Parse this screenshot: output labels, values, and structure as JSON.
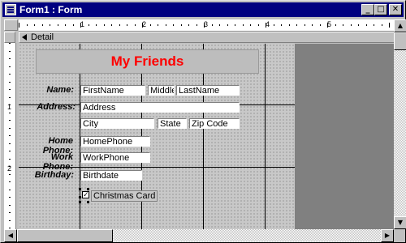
{
  "window": {
    "title": "Form1 : Form"
  },
  "section": {
    "label": "Detail"
  },
  "ruler": {
    "h_numbers": [
      "1",
      "2",
      "3",
      "4",
      "5"
    ],
    "v_numbers": [
      "1",
      "2"
    ]
  },
  "form": {
    "title": "My Friends",
    "labels": {
      "name": "Name:",
      "address": "Address:",
      "home_phone": "Home Phone:",
      "work_phone": "Work Phone:",
      "birthday": "Birthday:"
    },
    "fields": {
      "first_name": "FirstName",
      "middle": "Middle",
      "last_name": "LastName",
      "address": "Address",
      "city": "City",
      "state": "State",
      "zip": "Zip Code",
      "home_phone": "HomePhone",
      "work_phone": "WorkPhone",
      "birthdate": "Birthdate"
    },
    "checkbox": {
      "label": "Christmas Card",
      "checked": true
    }
  },
  "colors": {
    "title_text": "#ff0000",
    "titlebar": "#000080"
  }
}
